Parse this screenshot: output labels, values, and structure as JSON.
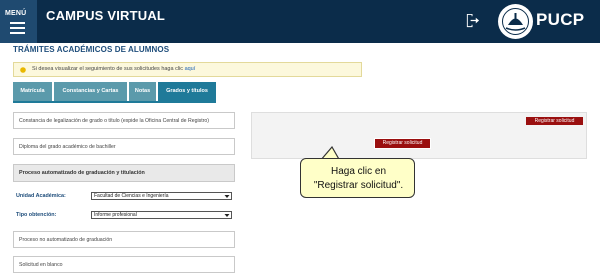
{
  "header": {
    "menu_label": "MENÚ",
    "app_title": "CAMPUS VIRTUAL",
    "brand": "PUCP",
    "logout_icon": "logout-icon",
    "color_bg": "#0b2c4a"
  },
  "page": {
    "title": "TRÁMITES ACADÉMICOS DE ALUMNOS"
  },
  "notice": {
    "text": "Si desea visualizar el seguimiento de sus solicitudes haga clic",
    "link": "aquí"
  },
  "tabs": [
    {
      "label": "Matrícula"
    },
    {
      "label": "Constancias y Cartas"
    },
    {
      "label": "Notas"
    },
    {
      "label": "Grados y títulos",
      "active": true
    }
  ],
  "items": {
    "constancia": "Constancia de legalización de grado o título (expide la Oficina Central de Registro)",
    "diploma": "Diploma del grado académico de bachiller",
    "proceso_auto": "Proceso automatizado de graduación y titulación",
    "proceso_no_auto": "Proceso no automatizado de graduación",
    "solicitud_blanco": "Solicitud en blanco"
  },
  "form": {
    "unidad_label": "Unidad Académica:",
    "unidad_value": "Facultad de Ciencias e Ingeniería",
    "tipo_label": "Tipo obtención:",
    "tipo_value": "Informe profesional"
  },
  "panel": {
    "btn_top": "Registrar solicitud",
    "btn_mid": "Registrar solicitud",
    "accent": "#9a0f0f"
  },
  "callout": {
    "line1": "Haga clic en",
    "line2": "\"Registrar solicitud\"."
  }
}
